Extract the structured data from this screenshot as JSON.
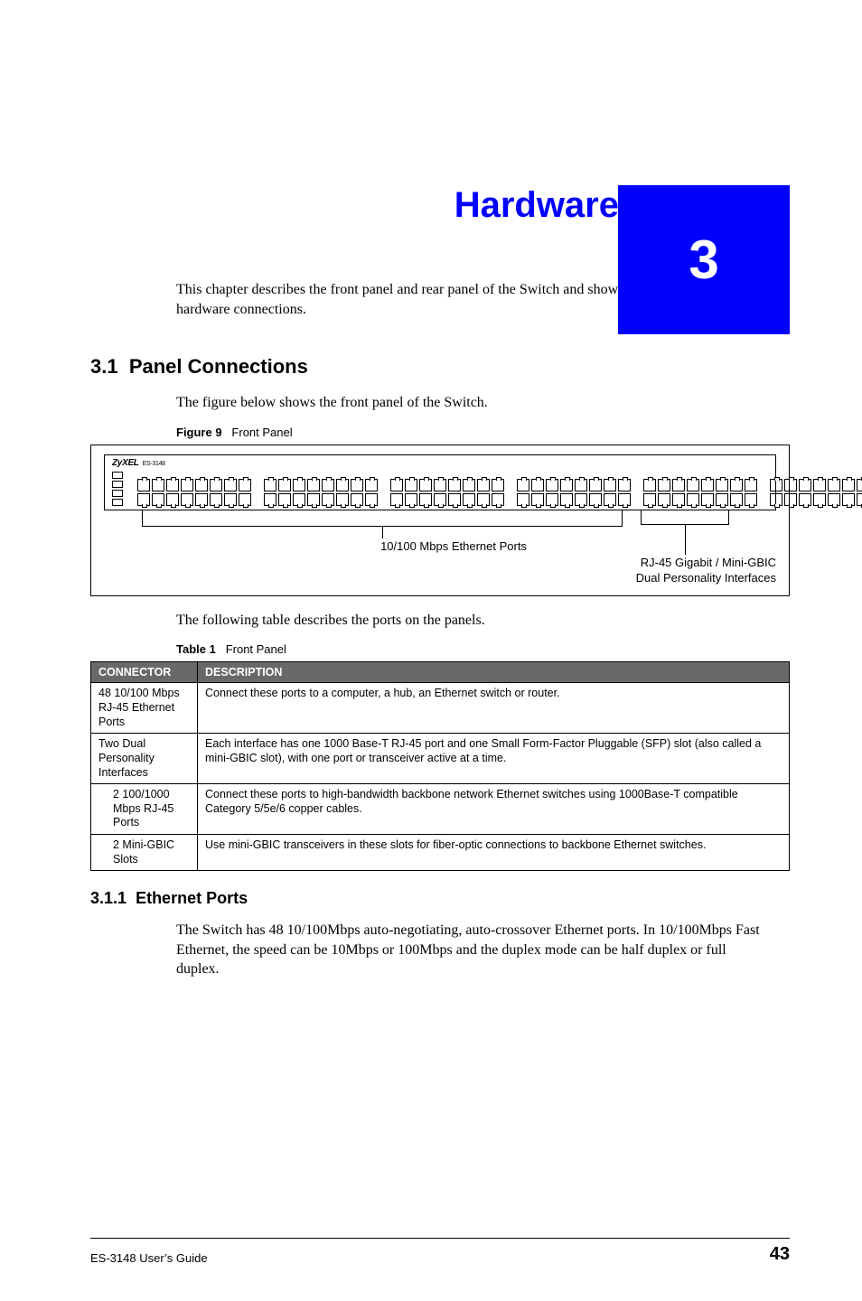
{
  "chapter_number": "3",
  "chapter_title": "Hardware Overview",
  "intro": "This chapter describes the front panel and rear panel of the Switch and shows you how to make the hardware connections.",
  "section1": {
    "num": "3.1",
    "title": "Panel Connections",
    "lead": "The figure below shows the front panel of the Switch."
  },
  "figure": {
    "label": "Figure 9",
    "title": "Front Panel",
    "brand": "ZyXEL",
    "model": "ES-3148",
    "eth_label": "10/100 Mbps Ethernet Ports",
    "gbic_label_1": "RJ-45 Gigabit / Mini-GBIC",
    "gbic_label_2": "Dual Personality Interfaces"
  },
  "between_fig_table": "The following table describes the ports on the panels.",
  "table": {
    "label": "Table 1",
    "title": "Front Panel",
    "headers": {
      "c1": "CONNECTOR",
      "c2": "DESCRIPTION"
    },
    "rows": [
      {
        "indent": false,
        "c1": "48 10/100 Mbps RJ-45 Ethernet Ports",
        "c2": "Connect these ports to a computer, a hub, an Ethernet switch or router."
      },
      {
        "indent": false,
        "c1": "Two Dual Personality Interfaces",
        "c2": "Each interface has one 1000 Base-T RJ-45 port and one Small Form-Factor Pluggable (SFP) slot (also called a mini-GBIC slot), with one port or transceiver active at a time."
      },
      {
        "indent": true,
        "c1": "2 100/1000 Mbps RJ-45 Ports",
        "c2": "Connect these ports to high-bandwidth backbone network Ethernet switches using 1000Base-T compatible Category 5/5e/6 copper cables."
      },
      {
        "indent": true,
        "c1": "2 Mini-GBIC Slots",
        "c2": "Use mini-GBIC transceivers in these slots for fiber-optic connections to backbone Ethernet switches."
      }
    ]
  },
  "section1_1": {
    "num": "3.1.1",
    "title": "Ethernet Ports",
    "body": "The Switch has 48 10/100Mbps auto-negotiating, auto-crossover Ethernet ports. In 10/100Mbps Fast Ethernet, the speed can be 10Mbps or 100Mbps and the duplex mode can be half duplex or full duplex."
  },
  "footer": {
    "guide": "ES-3148 User’s Guide",
    "page": "43"
  }
}
